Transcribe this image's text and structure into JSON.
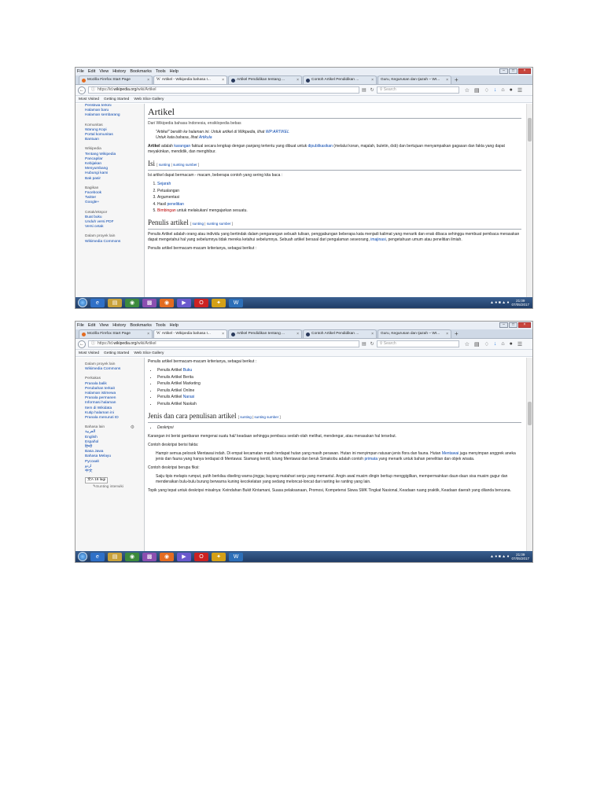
{
  "menu": [
    "File",
    "Edit",
    "View",
    "History",
    "Bookmarks",
    "Tools",
    "Help"
  ],
  "tabs": [
    {
      "title": "Mozilla Firefox Start Page",
      "icon": "firefox-icon"
    },
    {
      "title": "Artikel - Wikipedia bahasa I...",
      "icon": "wikipedia-icon"
    },
    {
      "title": "Artikel Pendidikan tentang ...",
      "icon": "blog-icon"
    },
    {
      "title": "Contoh Artikel Pendidikan ...",
      "icon": "blog-icon"
    },
    {
      "title": "Guru, Kegurusan dan Ijazah – WI...",
      "icon": "page-icon"
    }
  ],
  "url": {
    "prefix": "https://id.",
    "domain": "wikipedia.org",
    "path": "/wiki/Artikel"
  },
  "search_placeholder": "Search",
  "bookmarks": [
    "Most Visited",
    "Getting Started",
    "Web Slice Gallery"
  ],
  "shot1": {
    "sidebar": [
      {
        "t": "Peristiwa terkini",
        "k": "lnk"
      },
      {
        "t": "Halaman baru",
        "k": "lnk"
      },
      {
        "t": "Halaman sembarang",
        "k": "lnk"
      },
      {
        "t": "Komunitas",
        "k": "head"
      },
      {
        "t": "Warung Kopi",
        "k": "lnk"
      },
      {
        "t": "Portal komunitas",
        "k": "lnk"
      },
      {
        "t": "Bantuan",
        "k": "lnk"
      },
      {
        "t": "Wikipedia",
        "k": "head"
      },
      {
        "t": "Tentang Wikipedia",
        "k": "lnk"
      },
      {
        "t": "Pancapilar",
        "k": "lnk"
      },
      {
        "t": "Kebijakan",
        "k": "lnk"
      },
      {
        "t": "Menyumbang",
        "k": "lnk"
      },
      {
        "t": "Hubungi kami",
        "k": "lnk"
      },
      {
        "t": "Bak pasir",
        "k": "lnk"
      },
      {
        "t": "Bagikan",
        "k": "head"
      },
      {
        "t": "Facebook",
        "k": "lnk"
      },
      {
        "t": "Twitter",
        "k": "lnk"
      },
      {
        "t": "Google+",
        "k": "lnk"
      },
      {
        "t": "Cetak/ekspor",
        "k": "head"
      },
      {
        "t": "Buat buku",
        "k": "lnk"
      },
      {
        "t": "Unduh versi PDF",
        "k": "lnk"
      },
      {
        "t": "Versi cetak",
        "k": "lnk"
      },
      {
        "t": "Dalam proyek lain",
        "k": "head"
      },
      {
        "t": "Wikimedia Commons",
        "k": "lnk"
      }
    ],
    "title": "Artikel",
    "subtitle": "Dari Wikipedia bahasa Indonesia, ensiklopedia bebas",
    "hat1_pre": "\"Artikel\" beralih ke halaman ini. Untuk artikel di Wikipedia, lihat ",
    "hat1_link": "WP:ARTIKEL",
    "hat2_pre": "Untuk kata bahasa, lihat ",
    "hat2_link": "Artikula",
    "intro_bold": "Artikel",
    "intro_1": " adalah ",
    "intro_link1": "karangan",
    "intro_2": " faktual secara lengkap dengan panjang tertentu yang dibuat untuk ",
    "intro_link2": "dipublikasikan",
    "intro_3": " (melalui koran, majalah, buletin, dsb) dan bertujuan menyampaikan gagasan dan fakta yang dapat meyakinkan, mendidik, dan menghibur.",
    "h_isi": "Isi",
    "edit_links": [
      "sunting",
      "sunting sumber"
    ],
    "isi_intro": "Isi artikel dapat bermacam - macam, beberapa contoh yang sering kita baca :",
    "isi_list": [
      {
        "pre": "",
        "link": "Sejarah",
        "post": "",
        "cls": "a"
      },
      {
        "pre": "Petualangan",
        "link": "",
        "post": "",
        "cls": ""
      },
      {
        "pre": "Argumentasi",
        "link": "",
        "post": "",
        "cls": ""
      },
      {
        "pre": "Hasil ",
        "link": "penelitian",
        "post": "",
        "cls": "a"
      },
      {
        "pre": "",
        "link": "Bimbingan",
        "post": " untuk melakukan/ mengajarkan sesuatu.",
        "cls": "red"
      }
    ],
    "h_penulis": "Penulis artikel",
    "penulis_p1_a": "Penulis Artikel adalah orang atau individu yang bertindak dalam pengarangan sebuah tulisan, penggabungan beberapa kata menjadi kalimat yang menarik dan enak dibaca sehingga membuat pembaca merasakan dapat mengetahui hal yang sebelumnya tidak mereka ketahui sebelumnya. Sebuah artikel berasal dari pengalaman seseorang, ",
    "penulis_p1_link": "imajinasi",
    "penulis_p1_b": ", pengetahuan umum atau penelitian ilmiah.",
    "penulis_p2": "Penulis artikel bermacam-macam kriterianya, sebagai berikut :"
  },
  "shot2": {
    "sidebar": [
      {
        "t": "Dalam proyek lain",
        "k": "head"
      },
      {
        "t": "Wikimedia Commons",
        "k": "lnk"
      },
      {
        "t": "Perkakas",
        "k": "head"
      },
      {
        "t": "Pranala balik",
        "k": "lnk"
      },
      {
        "t": "Perubahan terkait",
        "k": "lnk"
      },
      {
        "t": "Halaman istimewa",
        "k": "lnk"
      },
      {
        "t": "Pranala permanen",
        "k": "lnk"
      },
      {
        "t": "Informasi halaman",
        "k": "lnk"
      },
      {
        "t": "Item di Wikidata",
        "k": "lnk"
      },
      {
        "t": "Kutip halaman ini",
        "k": "lnk"
      },
      {
        "t": "Pranala menuruti ID",
        "k": "lnk"
      }
    ],
    "lang_head": "Bahasa lain",
    "languages": [
      "العربية",
      "English",
      "Español",
      "हिन्दी",
      "Basa Jawa",
      "Bahasa Melayu",
      "Русский",
      "اردو",
      "中文"
    ],
    "lang_button": "文A 16 lagi",
    "edit_interwiki": "Sunting interwiki",
    "top_text": "Penulis artikel bermacam-macam kriterianya, sebagai berikut :",
    "writers": [
      {
        "pre": "Penulis Artikel ",
        "link": "Buku"
      },
      {
        "pre": "Penulis Artikel Berita",
        "link": ""
      },
      {
        "pre": "Penulis Artikel Marketing",
        "link": ""
      },
      {
        "pre": "Penulis Artikel Online",
        "link": ""
      },
      {
        "pre": "Penulis Artikel ",
        "link": "Narasi"
      },
      {
        "pre": "Penulis Artikel Naskah",
        "link": ""
      }
    ],
    "h_jenis": "Jenis dan cara penulisan artikel",
    "desk_label": "Deskripsi",
    "desk_def": "Karangan ini berisi gambaran mengenai suatu hal/ keadaan sehingga pembaca seolah-olah melihat, mendengar, atau merasakan hal tersebut.",
    "fakta_label": "Contoh deskripsi berisi fakta:",
    "fakta_a": "Hampir semua pelosok Mentawai indah. Di empat kecamatan masih terdapat hutan yang masih perawan. Hutan ini menyimpan ratusan jenis flora dan fauna. Hutan ",
    "fakta_link1": "Mentawai",
    "fakta_b": " juga menyimpan anggrek aneka jenis dan fauna yang hanya terdapat di Mentawai. Siamang kerdil, lutung Mentawai dan beruk Simakobu adalah contoh ",
    "fakta_link2": "primata",
    "fakta_c": " yang menarik untuk bahan penelitian dan objek wisata.",
    "fiksi_label": "Contoh deskripsi berupa fiksi:",
    "fiksi_text": "Saiju tipis melapis rumput, putih berkilau diseling warna jingga; bayang matahari senja yang memantul. Angin awal musim dingin bertiup menggigilkan, mempermainkan daun-daun sisa musim gugur dan menderaikan bulu-bulu burung berwarna kuning kecokelatan yang sedang meloncat-loncat dari ranting ke ranting yang lain.",
    "topik_text": "Topik yang tepat untuk deskripsi misalnya: Keindahan Bukit Kintamani, Suasa pelaksanaan, Promosi, Kompetensi Siswa SMK Tingkat Nasional, Keadaan ruang praktik, Keadaan daerah yang dilanda bencana."
  },
  "clock": {
    "time": "21:09",
    "date": "07/05/2017"
  }
}
